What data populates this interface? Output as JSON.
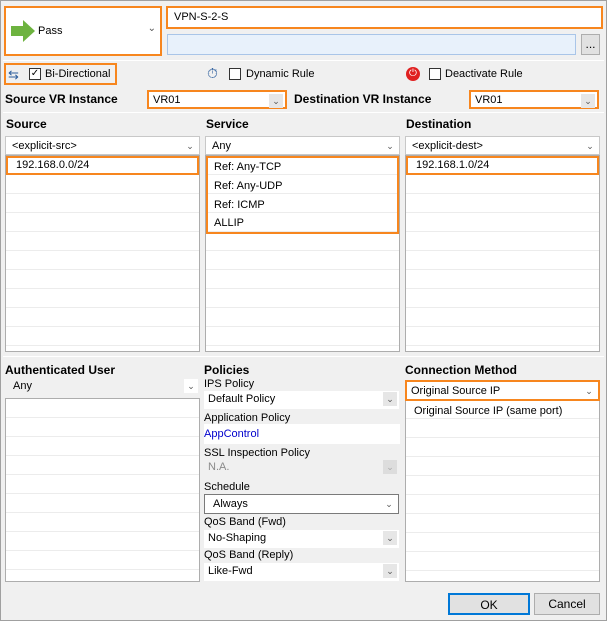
{
  "action": {
    "label": "Pass",
    "icon": "green-arrow-icon"
  },
  "rule_name": "VPN-S-2-S",
  "comment": "",
  "more_button": "...",
  "options": {
    "bidirectional": {
      "label": "Bi-Directional",
      "checked": true
    },
    "dynamic": {
      "label": "Dynamic Rule",
      "checked": false
    },
    "deactivate": {
      "label": "Deactivate Rule",
      "checked": false
    }
  },
  "vr": {
    "source_label": "Source VR Instance",
    "source_value": "VR01",
    "dest_label": "Destination VR Instance",
    "dest_value": "VR01"
  },
  "source": {
    "header": "Source",
    "select": "<explicit-src>",
    "items": [
      "192.168.0.0/24"
    ]
  },
  "service": {
    "header": "Service",
    "select": "Any",
    "items": [
      "Ref: Any-TCP",
      "Ref: Any-UDP",
      "Ref: ICMP",
      "ALLIP"
    ]
  },
  "destination": {
    "header": "Destination",
    "select": "<explicit-dest>",
    "items": [
      "192.168.1.0/24"
    ]
  },
  "auth": {
    "header": "Authenticated User",
    "select": "Any"
  },
  "policies": {
    "header": "Policies",
    "ips_label": "IPS Policy",
    "ips_value": "Default Policy",
    "app_label": "Application Policy",
    "app_value": "AppControl",
    "ssl_label": "SSL Inspection Policy",
    "ssl_value": "N.A.",
    "schedule_label": "Schedule",
    "schedule_value": "Always",
    "qos_fwd_label": "QoS Band (Fwd)",
    "qos_fwd_value": "No-Shaping",
    "qos_reply_label": "QoS Band (Reply)",
    "qos_reply_value": "Like-Fwd"
  },
  "connection": {
    "header": "Connection Method",
    "select": "Original Source IP",
    "items": [
      "Original Source IP (same port)"
    ]
  },
  "buttons": {
    "ok": "OK",
    "cancel": "Cancel"
  },
  "colors": {
    "highlight": "#f7861e",
    "link": "#0000cc",
    "ok_border": "#0078d7"
  }
}
